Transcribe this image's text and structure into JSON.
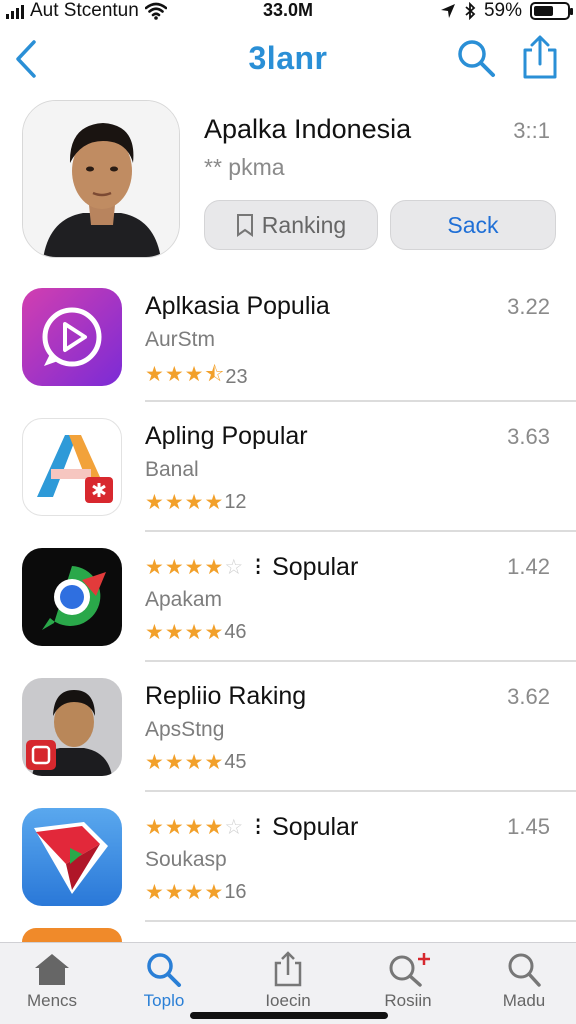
{
  "status_bar": {
    "carrier": "Aut Stcentun",
    "time": "33.0M",
    "battery": "59%",
    "battery_level": 0.59
  },
  "nav": {
    "title": "3lanr",
    "back_icon": "chevron-left-icon",
    "search_icon": "search-icon",
    "share_icon": "share-icon",
    "accent_color": "#2a8fd6"
  },
  "header": {
    "title": "Apalka Indonesia",
    "number": "3::1",
    "subtitle": "** pkma",
    "ranking_label": "Ranking",
    "sack_label": "Sack"
  },
  "apps": [
    {
      "title": "Aplkasia Populia",
      "subtitle": "AurStm",
      "rating_text": "23",
      "rating": 3.5,
      "number": "3.22",
      "icon": "play-circle-icon"
    },
    {
      "title": "Apling Popular",
      "subtitle": "Banal",
      "rating_text": "12",
      "rating": 4,
      "number": "3.63",
      "icon": "letter-a-icon"
    },
    {
      "title": "Sopular",
      "title_rating": 4,
      "subtitle": "Apakam",
      "rating_text": "46",
      "rating": 4,
      "number": "1.42",
      "icon": "compass-chat-icon"
    },
    {
      "title": "Repliio Raking",
      "subtitle": "ApsStng",
      "rating_text": "45",
      "rating": 4,
      "number": "3.62",
      "icon": "person-photo-icon"
    },
    {
      "title": "Sopular",
      "title_rating": 4,
      "subtitle": "Soukasp",
      "rating_text": "16",
      "rating": 4,
      "number": "1.45",
      "icon": "red-check-icon"
    }
  ],
  "tabs": [
    {
      "label": "Mencs",
      "icon": "home-icon"
    },
    {
      "label": "Toplo",
      "icon": "search-icon",
      "active": true
    },
    {
      "label": "Ioecin",
      "icon": "share-icon"
    },
    {
      "label": "Rosiin",
      "icon": "search-plus-icon"
    },
    {
      "label": "Madu",
      "icon": "search-icon"
    }
  ]
}
